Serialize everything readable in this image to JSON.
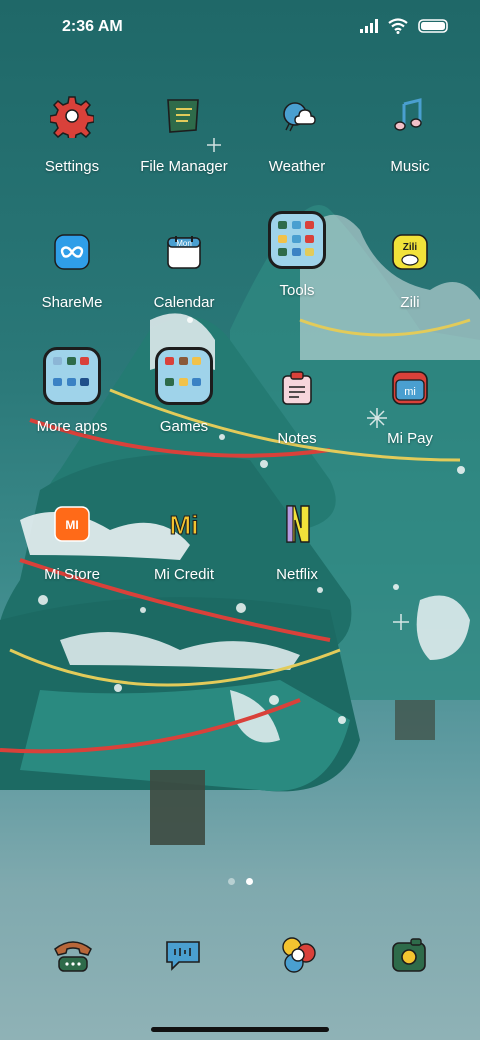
{
  "status_bar": {
    "time": "2:36 AM",
    "battery_level": 1.0
  },
  "apps": [
    {
      "label": "Settings",
      "icon": "settings-gear-icon"
    },
    {
      "label": "File Manager",
      "icon": "file-manager-icon"
    },
    {
      "label": "Weather",
      "icon": "weather-icon"
    },
    {
      "label": "Music",
      "icon": "music-note-icon"
    },
    {
      "label": "ShareMe",
      "icon": "shareme-infinity-icon"
    },
    {
      "label": "Calendar",
      "icon": "calendar-icon",
      "icon_text": "Mon"
    },
    {
      "label": "Tools",
      "icon": "tools-folder-icon"
    },
    {
      "label": "Zili",
      "icon": "zili-icon",
      "icon_text": "Zili"
    },
    {
      "label": "More apps",
      "icon": "more-apps-folder-icon"
    },
    {
      "label": "Games",
      "icon": "games-folder-icon"
    },
    {
      "label": "Notes",
      "icon": "notes-icon"
    },
    {
      "label": "Mi Pay",
      "icon": "mi-pay-icon",
      "icon_text": "mi"
    },
    {
      "label": "Mi Store",
      "icon": "mi-store-icon",
      "icon_text": "MI"
    },
    {
      "label": "Mi Credit",
      "icon": "mi-credit-icon",
      "icon_text": "Mi"
    },
    {
      "label": "Netflix",
      "icon": "netflix-icon",
      "icon_text": "N"
    }
  ],
  "page_indicator": {
    "pages": 2,
    "current": 2
  },
  "dock": [
    {
      "name": "phone-icon"
    },
    {
      "name": "messages-icon"
    },
    {
      "name": "gallery-icon"
    },
    {
      "name": "camera-icon"
    }
  ],
  "colors": {
    "accent_red": "#d9413a",
    "folder_fill": "#9fd3ea",
    "outline": "#1d1d1d"
  }
}
